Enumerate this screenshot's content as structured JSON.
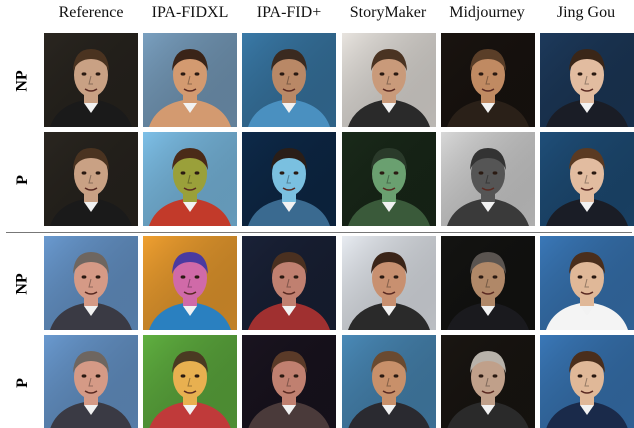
{
  "columns": [
    "Reference",
    "IPA-FIDXL",
    "IPA-FID+",
    "StoryMaker",
    "Midjourney",
    "Jing Gou"
  ],
  "rows": [
    {
      "label": "NP",
      "group": "subject-1"
    },
    {
      "label": "P",
      "group": "subject-1"
    },
    {
      "label": "NP",
      "group": "subject-2"
    },
    {
      "label": "P",
      "group": "subject-2"
    }
  ],
  "cells": [
    [
      {
        "desc": "man-dark-background",
        "bg": "#2a2620",
        "skin": "#c9a184",
        "hair": "#4a3320",
        "shirt": "#1a1a1a"
      },
      {
        "desc": "closeup-face",
        "bg": "#7aa0c0",
        "skin": "#d39a70",
        "hair": "#3a2418",
        "shirt": "#d39a70"
      },
      {
        "desc": "man-in-water",
        "bg": "#3a7aa8",
        "skin": "#b98866",
        "hair": "#3a2a20",
        "shirt": "#4a90c0"
      },
      {
        "desc": "framed-portrait",
        "bg": "#e8e4df",
        "skin": "#c99a7a",
        "hair": "#4a3322",
        "shirt": "#2a2a2a"
      },
      {
        "desc": "rugged-portrait",
        "bg": "#1a1410",
        "skin": "#c08a62",
        "hair": "#5a3e28",
        "shirt": "#2a2018"
      },
      {
        "desc": "young-man-suit",
        "bg": "#1d3a5c",
        "skin": "#e2bca0",
        "hair": "#3a2618",
        "shirt": "#1a1d26"
      }
    ],
    [
      {
        "desc": "man-dark-background",
        "bg": "#2a2620",
        "skin": "#c9a184",
        "hair": "#4a3320",
        "shirt": "#1a1a1a"
      },
      {
        "desc": "cartoon-grin-face",
        "bg": "#7ec0e8",
        "skin": "#9aa03a",
        "hair": "#4a2a18",
        "shirt": "#c23a2a"
      },
      {
        "desc": "glowing-blue-face",
        "bg": "#0e2a4a",
        "skin": "#7ac0e0",
        "hair": "#2a1e18",
        "shirt": "#3a6a90"
      },
      {
        "desc": "pixel-noise-face",
        "bg": "#1a2a1a",
        "skin": "#6aa070",
        "hair": "#2a3a2a",
        "shirt": "#3a5a3a"
      },
      {
        "desc": "dissolved-figure",
        "bg": "#d8d8d8",
        "skin": "#555555",
        "hair": "#333333",
        "shirt": "#3a3a3a"
      },
      {
        "desc": "long-hair-young-man",
        "bg": "#1f4f7a",
        "skin": "#e2bca0",
        "hair": "#5a3a22",
        "shirt": "#1a1d26"
      }
    ],
    [
      {
        "desc": "older-man-smiling",
        "bg": "#6a9ad0",
        "skin": "#d59a86",
        "hair": "#6e6660",
        "shirt": "#3a3a44"
      },
      {
        "desc": "pop-art-face",
        "bg": "#f0a030",
        "skin": "#d06aa8",
        "hair": "#4a3aa0",
        "shirt": "#2a80c0"
      },
      {
        "desc": "man-in-car",
        "bg": "#1a2238",
        "skin": "#c08070",
        "hair": "#4a3020",
        "shirt": "#a03030"
      },
      {
        "desc": "man-on-screen",
        "bg": "#e8ecf2",
        "skin": "#c89070",
        "hair": "#3a2418",
        "shirt": "#2a2a2a"
      },
      {
        "desc": "older-man-dark",
        "bg": "#141412",
        "skin": "#b08868",
        "hair": "#5a5450",
        "shirt": "#1a1a1e"
      },
      {
        "desc": "young-man-tie",
        "bg": "#3a78b8",
        "skin": "#e0b898",
        "hair": "#4a2e1c",
        "shirt": "#f4f4f4"
      }
    ],
    [
      {
        "desc": "older-man-smiling",
        "bg": "#6a9ad0",
        "skin": "#d59a86",
        "hair": "#6e6660",
        "shirt": "#3a3a44"
      },
      {
        "desc": "goggles-cartoon",
        "bg": "#60b040",
        "skin": "#e8b050",
        "hair": "#4a3a22",
        "shirt": "#c03a3a"
      },
      {
        "desc": "hand-on-screen",
        "bg": "#1a1420",
        "skin": "#c08070",
        "hair": "#5a3a28",
        "shirt": "#4a3a3a"
      },
      {
        "desc": "bearded-man",
        "bg": "#4a8ab8",
        "skin": "#c8906a",
        "hair": "#6a4a30",
        "shirt": "#2a2a30"
      },
      {
        "desc": "older-man-glasses",
        "bg": "#1a1612",
        "skin": "#c0a08a",
        "hair": "#b8b2aa",
        "shirt": "#2a2a2a"
      },
      {
        "desc": "young-man-glasses",
        "bg": "#3a78b8",
        "skin": "#e0b898",
        "hair": "#4a2e1c",
        "shirt": "#1a2a4a"
      }
    ]
  ]
}
